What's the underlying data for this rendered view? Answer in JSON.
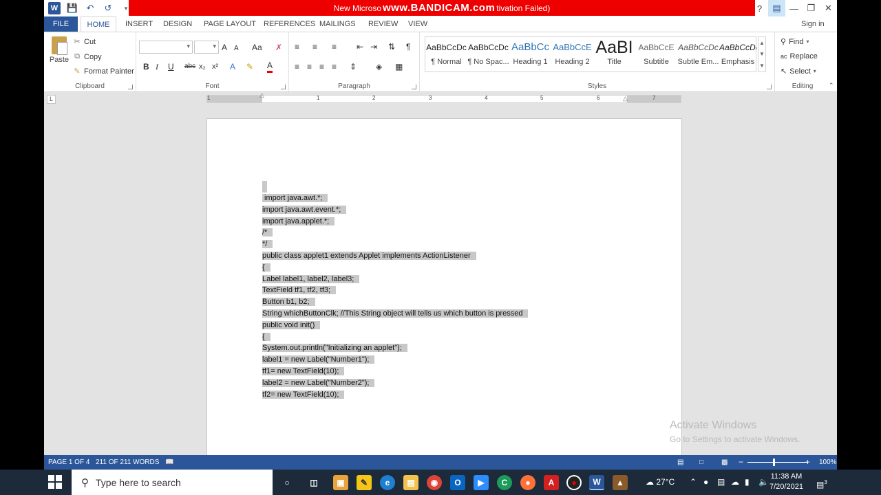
{
  "titlebar": {
    "title_left": "New Microso",
    "title_watermark": "www.BANDICAM.com",
    "title_right": "tivation Failed)",
    "help": "?",
    "minimize": "—",
    "restore": "❐",
    "close": "✕"
  },
  "tabs": [
    "FILE",
    "HOME",
    "INSERT",
    "DESIGN",
    "PAGE LAYOUT",
    "REFERENCES",
    "MAILINGS",
    "REVIEW",
    "VIEW"
  ],
  "sign_in": "Sign in",
  "ribbon": {
    "clipboard": {
      "label": "Clipboard",
      "paste": "Paste",
      "cut": "Cut",
      "copy": "Copy",
      "format_painter": "Format Painter"
    },
    "font": {
      "label": "Font",
      "bold": "B",
      "italic": "I",
      "underline": "U",
      "strike": "abc",
      "sub": "x₂",
      "sup": "x²",
      "grow": "A",
      "shrink": "A",
      "case": "Aa"
    },
    "paragraph": {
      "label": "Paragraph",
      "pilcrow": "¶"
    },
    "styles": {
      "label": "Styles",
      "items": [
        {
          "preview": "AaBbCcDc",
          "name": "¶ Normal"
        },
        {
          "preview": "AaBbCcDc",
          "name": "¶ No Spac..."
        },
        {
          "preview": "AaBbCc",
          "name": "Heading 1"
        },
        {
          "preview": "AaBbCcE",
          "name": "Heading 2"
        },
        {
          "preview": "AaBI",
          "name": "Title"
        },
        {
          "preview": "AaBbCcE",
          "name": "Subtitle"
        },
        {
          "preview": "AaBbCcDc",
          "name": "Subtle Em..."
        },
        {
          "preview": "AaBbCcDc",
          "name": "Emphasis"
        }
      ]
    },
    "editing": {
      "label": "Editing",
      "find": "Find",
      "replace": "Replace",
      "select": "Select"
    }
  },
  "ruler": {
    "numbers": [
      "1",
      "1",
      "2",
      "3",
      "4",
      "5",
      "6",
      "7"
    ]
  },
  "document": {
    "lines": [
      " import java.awt.*;",
      "import java.awt.event.*;",
      "import java.applet.*;",
      "/*",
      "*/",
      "public class applet1 extends Applet implements ActionListener",
      "{",
      "Label label1, label2, label3;",
      "TextField tf1, tf2, tf3;",
      "Button b1, b2;",
      "String whichButtonClk; //This String object will tells us which button is pressed",
      "public void init()",
      "{",
      "System.out.println(\"Initializing an applet\");",
      "label1 = new Label(\"Number1\");",
      "tf1= new TextField(10);",
      "label2 = new Label(\"Number2\");",
      "tf2= new TextField(10);"
    ]
  },
  "watermark": {
    "line1": "Activate Windows",
    "line2": "Go to Settings to activate Windows."
  },
  "statusbar": {
    "page": "PAGE 1 OF 4",
    "words": "211 OF 211 WORDS",
    "zoom": "100%",
    "minus": "−",
    "plus": "+"
  },
  "taskbar": {
    "search_placeholder": "Type here to search",
    "weather": "27°C",
    "time": "11:38 AM",
    "date": "7/20/2021",
    "notifications": "3"
  }
}
